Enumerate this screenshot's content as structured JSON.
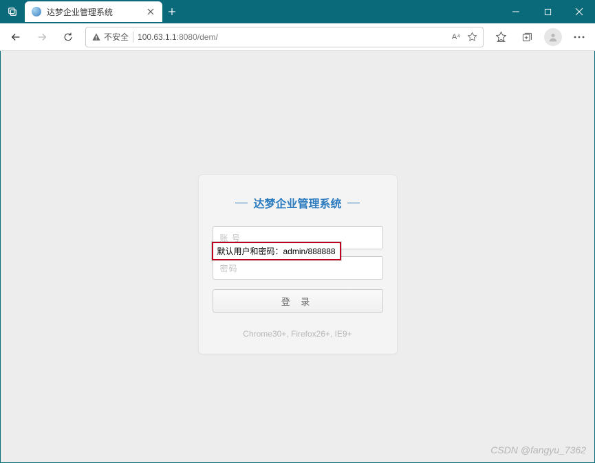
{
  "window": {
    "tab_title": "达梦企业管理系统"
  },
  "addressbar": {
    "security_label": "不安全",
    "url_prefix": "100.63.1.1",
    "url_suffix": ":8080/dem/",
    "reader_label": "A⁴"
  },
  "login": {
    "title": "达梦企业管理系统",
    "username_placeholder": "账 号",
    "password_placeholder": "密码",
    "button_label": "登 录",
    "compat_text": "Chrome30+, Firefox26+, IE9+",
    "callout_text": "默认用户和密码：admin/888888"
  },
  "watermark": "CSDN @fangyu_7362"
}
